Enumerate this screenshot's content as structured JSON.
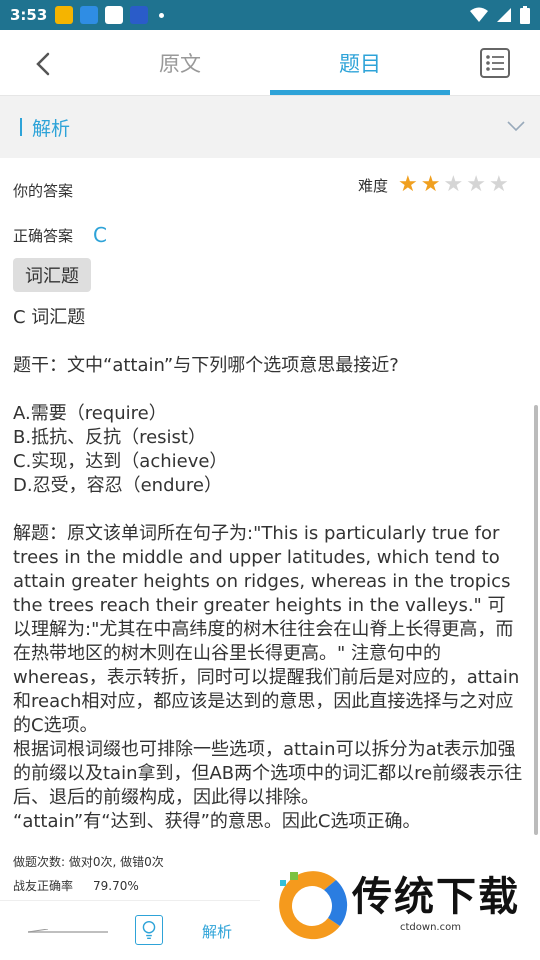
{
  "status_bar": {
    "time": "3:53"
  },
  "nav": {
    "tabs": [
      {
        "label": "原文"
      },
      {
        "label": "题目"
      }
    ]
  },
  "analysis_header": {
    "label": "解析"
  },
  "answer": {
    "your_answer_label": "你的答案",
    "difficulty_label": "难度",
    "difficulty_rating": 2,
    "difficulty_max": 5,
    "correct_label": "正确答案",
    "correct_value": "C",
    "tag": "词汇题"
  },
  "body": {
    "type_line": "C 词汇题",
    "stem": "题干：文中“attain”与下列哪个选项意思最接近?",
    "options": [
      "A.需要（require）",
      "B.抵抗、反抗（resist）",
      "C.实现，达到（achieve）",
      "D.忍受，容忍（endure）"
    ],
    "explanation_1": "解题：原文该单词所在句子为:\"This is particularly true for trees in the middle and upper latitudes, which tend to attain greater heights on ridges, whereas in the tropics the trees reach their greater heights in the valleys.\" 可以理解为:\"尤其在中高纬度的树木往往会在山脊上长得更高，而在热带地区的树木则在山谷里长得更高。\" 注意句中的whereas，表示转折，同时可以提醒我们前后是对应的，attain和reach相对应，都应该是达到的意思，因此直接选择与之对应的C选项。",
    "explanation_2": "根据词根词缀也可排除一些选项，attain可以拆分为at表示加强的前缀以及tain拿到，但AB两个选项中的词汇都以re前缀表示往后、退后的前缀构成，因此得以排除。",
    "explanation_3": "“attain”有“达到、获得”的意思。因此C选项正确。"
  },
  "stats": {
    "attempts": "做题次数: 做对0次, 做错0次",
    "rate_label": "战友正确率",
    "rate_value": "79.70%"
  },
  "toolbar": {
    "analysis_label": "解析"
  },
  "watermark": {
    "text": "传统下载",
    "url": "ctdown.com"
  },
  "colors": {
    "accent": "#2ea3d8",
    "status_bar": "#1f7390",
    "star_on": "#f0a020",
    "star_off": "#d5d5d5"
  }
}
